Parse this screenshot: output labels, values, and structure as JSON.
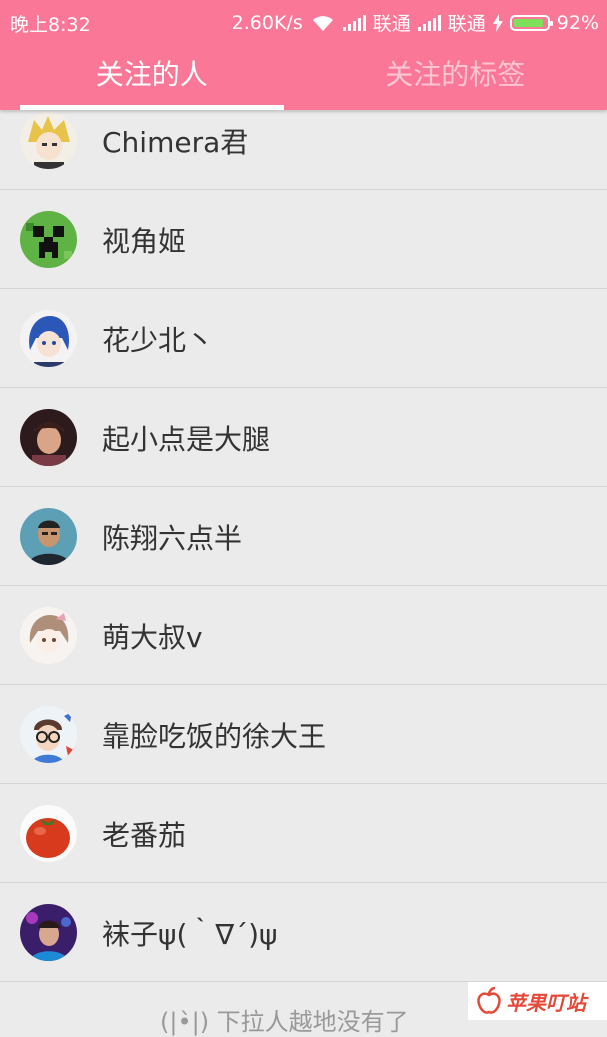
{
  "status_bar": {
    "time": "晚上8:32",
    "speed": "2.60K/s",
    "carrier1": "联通",
    "carrier2": "联通",
    "battery": "92%",
    "battery_level": 0.92
  },
  "tabs": [
    {
      "label": "关注的人",
      "active": true
    },
    {
      "label": "关注的标签",
      "active": false
    }
  ],
  "following": [
    {
      "name": "Chimera君",
      "avatar": "anime-blonde-avatar"
    },
    {
      "name": "视角姬",
      "avatar": "creeper-face-avatar"
    },
    {
      "name": "花少北丶",
      "avatar": "anime-blue-hair-avatar"
    },
    {
      "name": "起小点是大腿",
      "avatar": "person-photo-avatar"
    },
    {
      "name": "陈翔六点半",
      "avatar": "person-photo-avatar"
    },
    {
      "name": "萌大叔v",
      "avatar": "anime-sketch-avatar"
    },
    {
      "name": "靠脸吃饭的徐大王",
      "avatar": "cartoon-glasses-avatar"
    },
    {
      "name": "老番茄",
      "avatar": "tomato-avatar"
    },
    {
      "name": "袜子ψ(｀∇´)ψ",
      "avatar": "purple-photo-avatar"
    }
  ],
  "bottom_partial_text": "(|•̀|) 下拉人越地没有了",
  "watermark": "苹果叮站",
  "colors": {
    "header": "#fb7798",
    "tab_active": "#ffffff",
    "tab_inactive": "#fcc5d2",
    "background": "#ebebeb"
  }
}
